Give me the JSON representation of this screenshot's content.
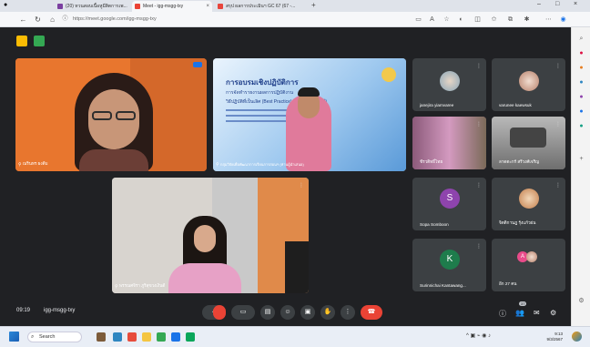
{
  "browser": {
    "tabs": [
      {
        "label": "(20) ทวนสอบเนื้อหูมีสิตการเพ...",
        "color": "#7b3fa0",
        "active": false
      },
      {
        "label": "Meet - igg-msgg-txy",
        "color": "#ea4335",
        "active": true
      },
      {
        "label": "สรุป ผลการประเมินฯ GC 67 (67 -...",
        "color": "#e8453c",
        "active": false
      }
    ],
    "new_tab": "+",
    "url": "https://meet.google.com/igg-msgg-txy",
    "window_controls": [
      "–",
      "□",
      "×"
    ]
  },
  "meet": {
    "meeting_time": "09:19",
    "meeting_code": "igg-msgg-txy",
    "main_tiles": [
      {
        "name": "ณรินทร ผงดีบ",
        "kind": "woman-glasses"
      },
      {
        "name": "กลุ่มวิจัยเพื่อพัฒนาการเรียนการสอนฯ (ท่านผู้นำเสนอ)",
        "kind": "presentation"
      },
      {
        "name": "พรรณศจิรา ภูริสุขวงเงินดี",
        "kind": "woman-pink"
      }
    ],
    "slide": {
      "title": "การอบรมเชิงปฏิบัติการ",
      "line1": "การจัดทำรายงานผลการปฏิบัติงาน",
      "line2": "วิธีปฏิบัติที่เป็นเลิศ (Best Practice) (รูปแบบออนไลน์)"
    },
    "side_tiles": [
      {
        "name": "janejira yiamvaree",
        "kind": "photo",
        "color": "#3c4043"
      },
      {
        "name": "varunee kaewsuk",
        "kind": "photo",
        "color": "#3c4043"
      },
      {
        "name": "ชีรวติทธิ์ไทย",
        "kind": "photo",
        "color": "#b56ea0"
      },
      {
        "name": "ลาดตะกร์ สรีวงศ์เจริญ",
        "kind": "photo",
        "color": "#8e8e8e"
      },
      {
        "name": "Sopa Somboon",
        "kind": "letter",
        "letter": "S",
        "color": "#8e44ad"
      },
      {
        "name": "จิตติกานฎ รุ้งแก้วฝน",
        "kind": "photo",
        "color": "#3c4043"
      },
      {
        "name": "Surinnichai Kantawang...",
        "kind": "letter",
        "letter": "K",
        "color": "#1e7c4c"
      },
      {
        "name": "อีก 27 คน",
        "kind": "others",
        "color": "#3c4043"
      }
    ],
    "controls": {
      "mic": "mic-off-icon",
      "camera": "camera-icon",
      "captions": "captions-icon",
      "emoji": "emoji-icon",
      "present": "present-icon",
      "raise_hand": "raise-hand-icon",
      "more": "more-icon",
      "hangup": "hangup-icon"
    },
    "participant_badge": "37"
  },
  "taskbar": {
    "search_placeholder": "Search",
    "clock_time": "9:13",
    "clock_date": "9/3/2567"
  }
}
